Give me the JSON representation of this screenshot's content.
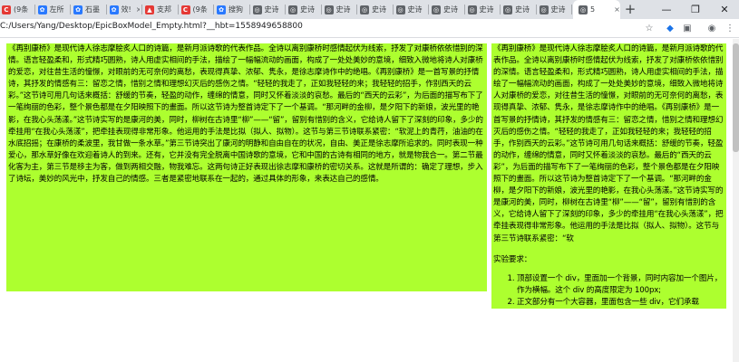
{
  "browser": {
    "tabs": [
      {
        "label": "(9条",
        "icon": "c-red-icon",
        "color": "#e53935",
        "glyph": "C"
      },
      {
        "label": "左所",
        "icon": "paw-icon",
        "color": "#2979ff",
        "glyph": "✿"
      },
      {
        "label": "石墨",
        "icon": "paw-icon",
        "color": "#2979ff",
        "glyph": "✿"
      },
      {
        "label": "效!",
        "icon": "paw-icon",
        "color": "#2979ff",
        "glyph": "✿"
      },
      {
        "label": "支邦",
        "icon": "flame-icon",
        "color": "#e53935",
        "glyph": "▲"
      },
      {
        "label": "(9条",
        "icon": "c-red-icon",
        "color": "#e53935",
        "glyph": "C"
      },
      {
        "label": "搜狗",
        "icon": "paw-icon",
        "color": "#2979ff",
        "glyph": "✿"
      },
      {
        "label": "史诗",
        "icon": "globe-icon",
        "color": "#5f6368",
        "glyph": "◎"
      },
      {
        "label": "史诗",
        "icon": "globe-icon",
        "color": "#5f6368",
        "glyph": "◎"
      },
      {
        "label": "史诗",
        "icon": "globe-icon",
        "color": "#5f6368",
        "glyph": "◎"
      },
      {
        "label": "史诗",
        "icon": "globe-icon",
        "color": "#5f6368",
        "glyph": "◎"
      },
      {
        "label": "史诗",
        "icon": "globe-icon",
        "color": "#5f6368",
        "glyph": "◎"
      },
      {
        "label": "史诗",
        "icon": "globe-icon",
        "color": "#5f6368",
        "glyph": "◎"
      },
      {
        "label": "史诗",
        "icon": "globe-icon",
        "color": "#5f6368",
        "glyph": "◎"
      },
      {
        "label": "史诗",
        "icon": "globe-icon",
        "color": "#5f6368",
        "glyph": "◎"
      },
      {
        "label": "史诗",
        "icon": "globe-icon",
        "color": "#5f6368",
        "glyph": "◎"
      }
    ],
    "active_tab": {
      "label": "5",
      "icon": "globe-icon",
      "glyph": "◎"
    },
    "new_tab_label": "+",
    "window_buttons": {
      "minimize": "—",
      "maximize": "❐",
      "close": "✕"
    },
    "address": "C:/Users/Yang/Desktop/EpicBoxModel_Empty.html?__hbt=1558949658800",
    "toolbar_icons": [
      "star-icon",
      "extension-icon",
      "cast-icon",
      "profile-icon",
      "menu-icon"
    ]
  },
  "page": {
    "left_text": "《再别康桥》是现代诗人徐志摩脍炙人口的诗篇，是新月派诗歌的代表作品。全诗以离别康桥时感情起伏为线索，抒发了对康桥依依惜别的深情。语言轻盈柔和，形式精巧圆熟，诗人用虚实相间的手法，描绘了一幅幅流动的画面，构成了一处处美妙的意境，细致入微地将诗人对康桥的爱恋，对往昔生活的憧憬，对眼前的无可奈何的离愁，表现得真挚、浓郁、隽永，是徐志摩诗作中的绝唱。《再别康桥》是一首写景的抒情诗，其抒发的情感有三：留恋之情，惜别之情和理想幻灭后的感伤之情。“轻轻的我走了，正如我轻轻的来；我轻轻的招手，作别西天的云彩。”这节诗可用几句话来概括：舒缓的节奏，轻盈的动作，缠绵的情意，同时又怀着淡淡的哀愁。最后的“西天的云彩”，为后面的描写布下了一笔绚丽的色彩，整个景色都是在夕阳映照下的畫面。所以这节诗为整首诗定下了一个基调。“那河畔的金柳，是夕阳下的新娘，波光里的艳影，在我心头荡漾。”这节诗实写的是康河的美，同时，柳树在古诗里“柳”——“留”，留别有惜别的含义，它给诗人留下了深刻的印象，多少的牵挂用“在我心头荡漾”，把牵挂表现得非常形象。他运用的手法是比拟（拟人、拟物）。这节与第三节诗联系紧密：“软泥上的青荇，油油的在水底招摇；在康桥的柔波里，我甘做一条水草。”第三节诗突出了康河的明静和自由自在的状况，自由、美正是徐志摩所追求的。同时表现一种爱心，那水草好像在欢迎着诗人的到来。还有，它并没有完全脱离中国诗歌的意境，它和中国的古诗有相同的地方，就是物我合一。第二节最化客为主，第三节是移主为客，做到两相交融，物我难忘。这两句诗正好表现出徐志摩和康桥的密切关系。这就是所谓的：确定了理想，步入了诗坛，美妙的风光中，抒发自己的情感。三者是紧密地联系在一起的，通过具体的形象，来表达自己的感情。",
    "right_text": "《再别康桥》是现代诗人徐志摩脍炙人口的诗篇，是新月派诗歌的代表作品。全诗以离别康桥时感情起伏为线索，抒发了对康桥依依惜别的深情。语言轻盈柔和，形式精巧圆熟，诗人用虚实相间的手法，描绘了一幅幅流动的画面，构成了一处处美妙的意境，细致入微地将诗人对康桥的爱恋，对往昔生活的憧憬，对眼前的无可奈何的离愁，表现得真挚、浓郁、隽永，是徐志摩诗作中的绝唱。《再别康桥》是一首写景的抒情诗，其抒发的情感有三：留恋之情，惜别之情和理想幻灭后的感伤之情。“轻轻的我走了，正如我轻轻的来；我轻轻的招手，作别西天的云彩。”这节诗可用几句话来概括：舒缓的节奏，轻盈的动作，缠绵的情意，同时又怀着淡淡的哀愁。最后的“西天的云彩”，为后面的描写布下了一笔绚丽的色彩，整个景色都是在夕阳映照下的畫面。所以这节诗为整首诗定下了一个基调。“那河畔的金柳，是夕阳下的新娘，波光里的艳影，在我心头荡漾。”这节诗实写的是康河的美，同时，柳树在古诗里“柳”——“留”，留别有惜别的含义，它给诗人留下了深刻的印象，多少的牵挂用“在我心头荡漾”，把牵挂表现得非常形象。他运用的手法是比拟（拟人、拟物）。这节与第三节诗联系紧密：“软",
    "requirements_title": "实验要求：",
    "requirements": [
      "顶部设置一个 div，里面加一个背景，同时内容加一个图片，作为横幅。这个 div 的高度限定为 100px;",
      "正文部分有一个大容器，里面包含一些 div，它们承载"
    ],
    "box_color": "#adff2f"
  }
}
